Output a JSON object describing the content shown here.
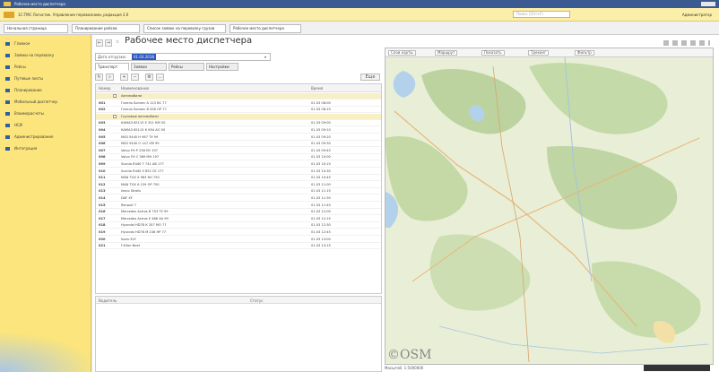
{
  "window": {
    "title": "Рабочее место диспетчера"
  },
  "app": {
    "path_title": "1С:ТМС Логистик. Управление перевозками, редакция 3.0",
    "search_placeholder": "Поиск (Ctrl+F)",
    "user": "Администратор"
  },
  "tabs": [
    {
      "label": "Начальная страница"
    },
    {
      "label": "Планирование рейсов"
    },
    {
      "label": "Список заявок на перевозку грузов"
    },
    {
      "label": "Рабочее место диспетчера"
    }
  ],
  "sidebar": {
    "items": [
      {
        "label": "Главное"
      },
      {
        "label": "Заявки на перевозку"
      },
      {
        "label": "Рейсы"
      },
      {
        "label": "Путевые листы"
      },
      {
        "label": "Планирование"
      },
      {
        "label": "Мобильный диспетчер"
      },
      {
        "label": "Взаиморасчеты"
      },
      {
        "label": "НСИ"
      },
      {
        "label": "Администрирование"
      },
      {
        "label": "Интеграция"
      }
    ]
  },
  "page": {
    "title": "Рабочее место диспетчера",
    "back": "←",
    "forward": "→",
    "star": "☆"
  },
  "filter": {
    "label": "Дата отгрузки:",
    "value": "01.03.2018",
    "dropdown": "▾"
  },
  "subtabs": [
    {
      "label": "Транспорт"
    },
    {
      "label": "Заявки"
    },
    {
      "label": "Рейсы"
    },
    {
      "label": "Настройки"
    }
  ],
  "toolbar": {
    "refresh": "↻",
    "find": "⌕",
    "expand": "+",
    "collapse": "−",
    "settings": "⚙",
    "more": "…",
    "list_label": "Еще"
  },
  "table": {
    "headers": {
      "code": "Номер",
      "name": "Наименование",
      "time": "Время"
    },
    "rows": [
      {
        "code": "",
        "name": "Автомобили",
        "time": "",
        "group": true
      },
      {
        "code": "001",
        "name": "Газель Бизнес А 123 ВС 77",
        "time": "01.03 08:00",
        "group": false
      },
      {
        "code": "002",
        "name": "Газель Бизнес В 456 ОР 77",
        "time": "01.03 08:15",
        "group": false
      },
      {
        "code": "",
        "name": "Грузовые автомобили",
        "time": "",
        "group": true
      },
      {
        "code": "003",
        "name": "КАМАЗ 65115 Е 321 КМ 50",
        "time": "01.03 09:00",
        "group": false
      },
      {
        "code": "004",
        "name": "КАМАЗ 65115 К 654 АО 50",
        "time": "01.03 09:10",
        "group": false
      },
      {
        "code": "005",
        "name": "МАЗ 5440 Н 987 ТУ 99",
        "time": "01.03 09:20",
        "group": false
      },
      {
        "code": "006",
        "name": "МАЗ 5440 О 147 ХМ 99",
        "time": "01.03 09:30",
        "group": false
      },
      {
        "code": "007",
        "name": "Volvo FH Р 258 ЕК 197",
        "time": "01.03 09:45",
        "group": false
      },
      {
        "code": "008",
        "name": "Volvo FH С 369 МН 197",
        "time": "01.03 10:00",
        "group": false
      },
      {
        "code": "009",
        "name": "Scania R440 Т 741 АВ 177",
        "time": "01.03 10:15",
        "group": false
      },
      {
        "code": "010",
        "name": "Scania R440 У 852 СЕ 177",
        "time": "01.03 10:30",
        "group": false
      },
      {
        "code": "011",
        "name": "MAN TGX Х 963 КН 750",
        "time": "01.03 10:45",
        "group": false
      },
      {
        "code": "012",
        "name": "MAN TGX А 159 ОР 750",
        "time": "01.03 11:00",
        "group": false
      },
      {
        "code": "013",
        "name": "Iveco Stralis",
        "time": "01.03 11:15",
        "group": false
      },
      {
        "code": "014",
        "name": "DAF XF",
        "time": "01.03 11:30",
        "group": false
      },
      {
        "code": "015",
        "name": "Renault T",
        "time": "01.03 11:45",
        "group": false
      },
      {
        "code": "016",
        "name": "Mercedes Actros В 753 ТУ 99",
        "time": "01.03 12:00",
        "group": false
      },
      {
        "code": "017",
        "name": "Mercedes Actros Е 486 ХА 99",
        "time": "01.03 12:15",
        "group": false
      },
      {
        "code": "018",
        "name": "Hyundai HD78 К 357 МО 77",
        "time": "01.03 12:30",
        "group": false
      },
      {
        "code": "019",
        "name": "Hyundai HD78 М 246 НР 77",
        "time": "01.03 12:45",
        "group": false
      },
      {
        "code": "020",
        "name": "Isuzu ELF",
        "time": "01.03 13:00",
        "group": false
      },
      {
        "code": "021",
        "name": "ГАЗон Next",
        "time": "01.03 13:15",
        "group": false
      }
    ]
  },
  "lower": {
    "col1": "Водитель",
    "col2": "Статус"
  },
  "map": {
    "toolbar": [
      "Слои карты",
      "Маршрут",
      "Показать",
      "Трекинг",
      "Фильтр"
    ],
    "attribution": "©OSM",
    "footer": "Масштаб: 1:5000000",
    "colors": {
      "land": "#e8efd6",
      "forest": "#bcd3a0",
      "water": "#b3d1ea",
      "road": "#e9b57a"
    }
  }
}
